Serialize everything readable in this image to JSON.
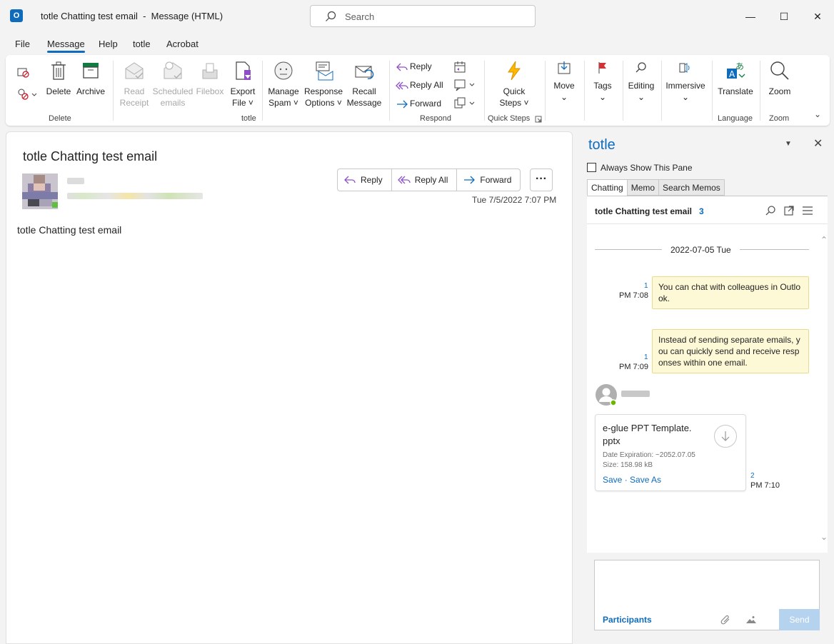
{
  "titlebar": {
    "title": "totle Chatting test email  -  Message (HTML)",
    "search_placeholder": "Search",
    "minimize": "—",
    "maximize": "☐",
    "close": "✕"
  },
  "menu": [
    "File",
    "Message",
    "Help",
    "totle",
    "Acrobat"
  ],
  "ribbon": {
    "delete_group": {
      "label": "Delete",
      "delete": "Delete",
      "archive": "Archive"
    },
    "totle_group": {
      "label": "totle",
      "read_receipt": [
        "Read",
        "Receipt"
      ],
      "scheduled_emails": [
        "Scheduled",
        "emails"
      ],
      "filebox": "Filebox",
      "export_file": [
        "Export",
        "File ˅"
      ],
      "manage_spam": [
        "Manage",
        "Spam ˅"
      ],
      "response_options": [
        "Response",
        "Options ˅"
      ],
      "recall_message": [
        "Recall",
        "Message"
      ]
    },
    "respond_group": {
      "label": "Respond",
      "reply": "Reply",
      "reply_all": "Reply All",
      "forward": "Forward"
    },
    "quick_steps": {
      "label": "Quick Steps",
      "btn": [
        "Quick",
        "Steps ˅"
      ]
    },
    "move": "Move",
    "tags": "Tags",
    "editing": "Editing",
    "immersive": "Immersive",
    "language_group": {
      "label": "Language",
      "translate": "Translate"
    },
    "zoom_group": {
      "label": "Zoom",
      "zoom": "Zoom"
    }
  },
  "message": {
    "subject": "totle Chatting test email",
    "actions": {
      "reply": "Reply",
      "reply_all": "Reply All",
      "forward": "Forward"
    },
    "more": "···",
    "date": "Tue 7/5/2022 7:07 PM",
    "body": "totle Chatting test email"
  },
  "side_pane": {
    "title": "totle",
    "always_show": "Always Show This Pane",
    "tabs": [
      "Chatting",
      "Memo",
      "Search Memos"
    ],
    "chat": {
      "header": "totle Chatting test email",
      "count": "3",
      "date_separator": "2022-07-05 Tue",
      "messages": [
        {
          "lines": [
            "You can chat with colleagues in Outlo",
            "ok."
          ],
          "num": "1",
          "time": "PM 7:08"
        },
        {
          "lines": [
            "Instead of sending separate emails, y",
            "ou can quickly send and receive resp",
            "onses within one email."
          ],
          "num": "1",
          "time": "PM 7:09"
        }
      ],
      "file": {
        "name_lines": [
          "e-glue PPT Template.",
          "pptx"
        ],
        "expiration": "Date Expiration: ~2052.07.05",
        "size": "Size: 158.98 kB",
        "save": "Save",
        "dot": " · ",
        "save_as": "Save As",
        "num": "2",
        "time": "PM 7:10"
      }
    },
    "compose": {
      "participants": "Participants",
      "send": "Send"
    }
  }
}
